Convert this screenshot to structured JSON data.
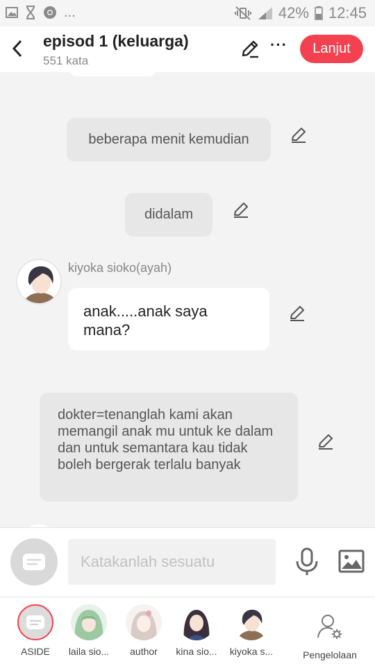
{
  "status_bar": {
    "battery": "42%",
    "time": "12:45",
    "dots": "..."
  },
  "header": {
    "title": "episod 1 (keluarga)",
    "word_count": "551 kata",
    "continue_label": "Lanjut",
    "more_label": "···"
  },
  "chat": {
    "messages": [
      {
        "type": "narration",
        "text": "beberapa menit kemudian"
      },
      {
        "type": "narration",
        "text": "didalam"
      },
      {
        "type": "dialogue",
        "speaker": "kiyoka sioko(ayah)",
        "text": "anak.....anak saya mana?"
      },
      {
        "type": "narration",
        "text": "dokter=tenanglah kami akan memangil anak mu untuk ke dalam dan untuk semantara kau tidak boleh bergerak terlalu banyak"
      }
    ]
  },
  "input": {
    "placeholder": "Katakanlah sesuatu"
  },
  "characters": [
    {
      "label": "ASIDE"
    },
    {
      "label": "laila sio..."
    },
    {
      "label": "author"
    },
    {
      "label": "kina sio..."
    },
    {
      "label": "kiyoka s..."
    }
  ],
  "manage_label": "Pengelolaan",
  "colors": {
    "accent": "#f44150",
    "narration_bg": "#e7e7e7",
    "bubble_bg": "#ffffff",
    "chat_bg": "#f3f3f3"
  }
}
